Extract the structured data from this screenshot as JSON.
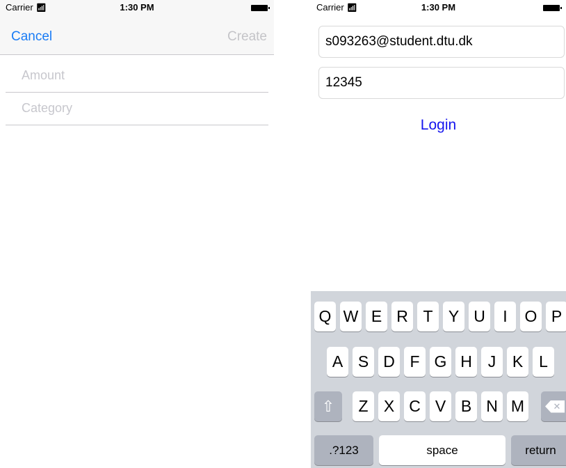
{
  "left_screen": {
    "status_bar": {
      "carrier": "Carrier",
      "wifi_icon": "wifi-icon",
      "time": "1:30 PM",
      "battery_icon": "battery-icon"
    },
    "nav": {
      "cancel_label": "Cancel",
      "create_label": "Create"
    },
    "form": {
      "amount_placeholder": "Amount",
      "category_placeholder": "Category"
    }
  },
  "right_screen": {
    "status_bar": {
      "carrier": "Carrier",
      "wifi_icon": "wifi-icon",
      "time": "1:30 PM",
      "battery_icon": "battery-icon"
    },
    "email_value": "s093263@student.dtu.dk",
    "password_value": "12345",
    "login_label": "Login",
    "keyboard": {
      "row1": [
        "Q",
        "W",
        "E",
        "R",
        "T",
        "Y",
        "U",
        "I",
        "O",
        "P"
      ],
      "row2": [
        "A",
        "S",
        "D",
        "F",
        "G",
        "H",
        "J",
        "K",
        "L"
      ],
      "row3": [
        "Z",
        "X",
        "C",
        "V",
        "B",
        "N",
        "M"
      ],
      "shift_icon": "shift-icon",
      "delete_icon": "delete-icon",
      "numbers_label": ".?123",
      "space_label": "space",
      "return_label": "return"
    }
  }
}
